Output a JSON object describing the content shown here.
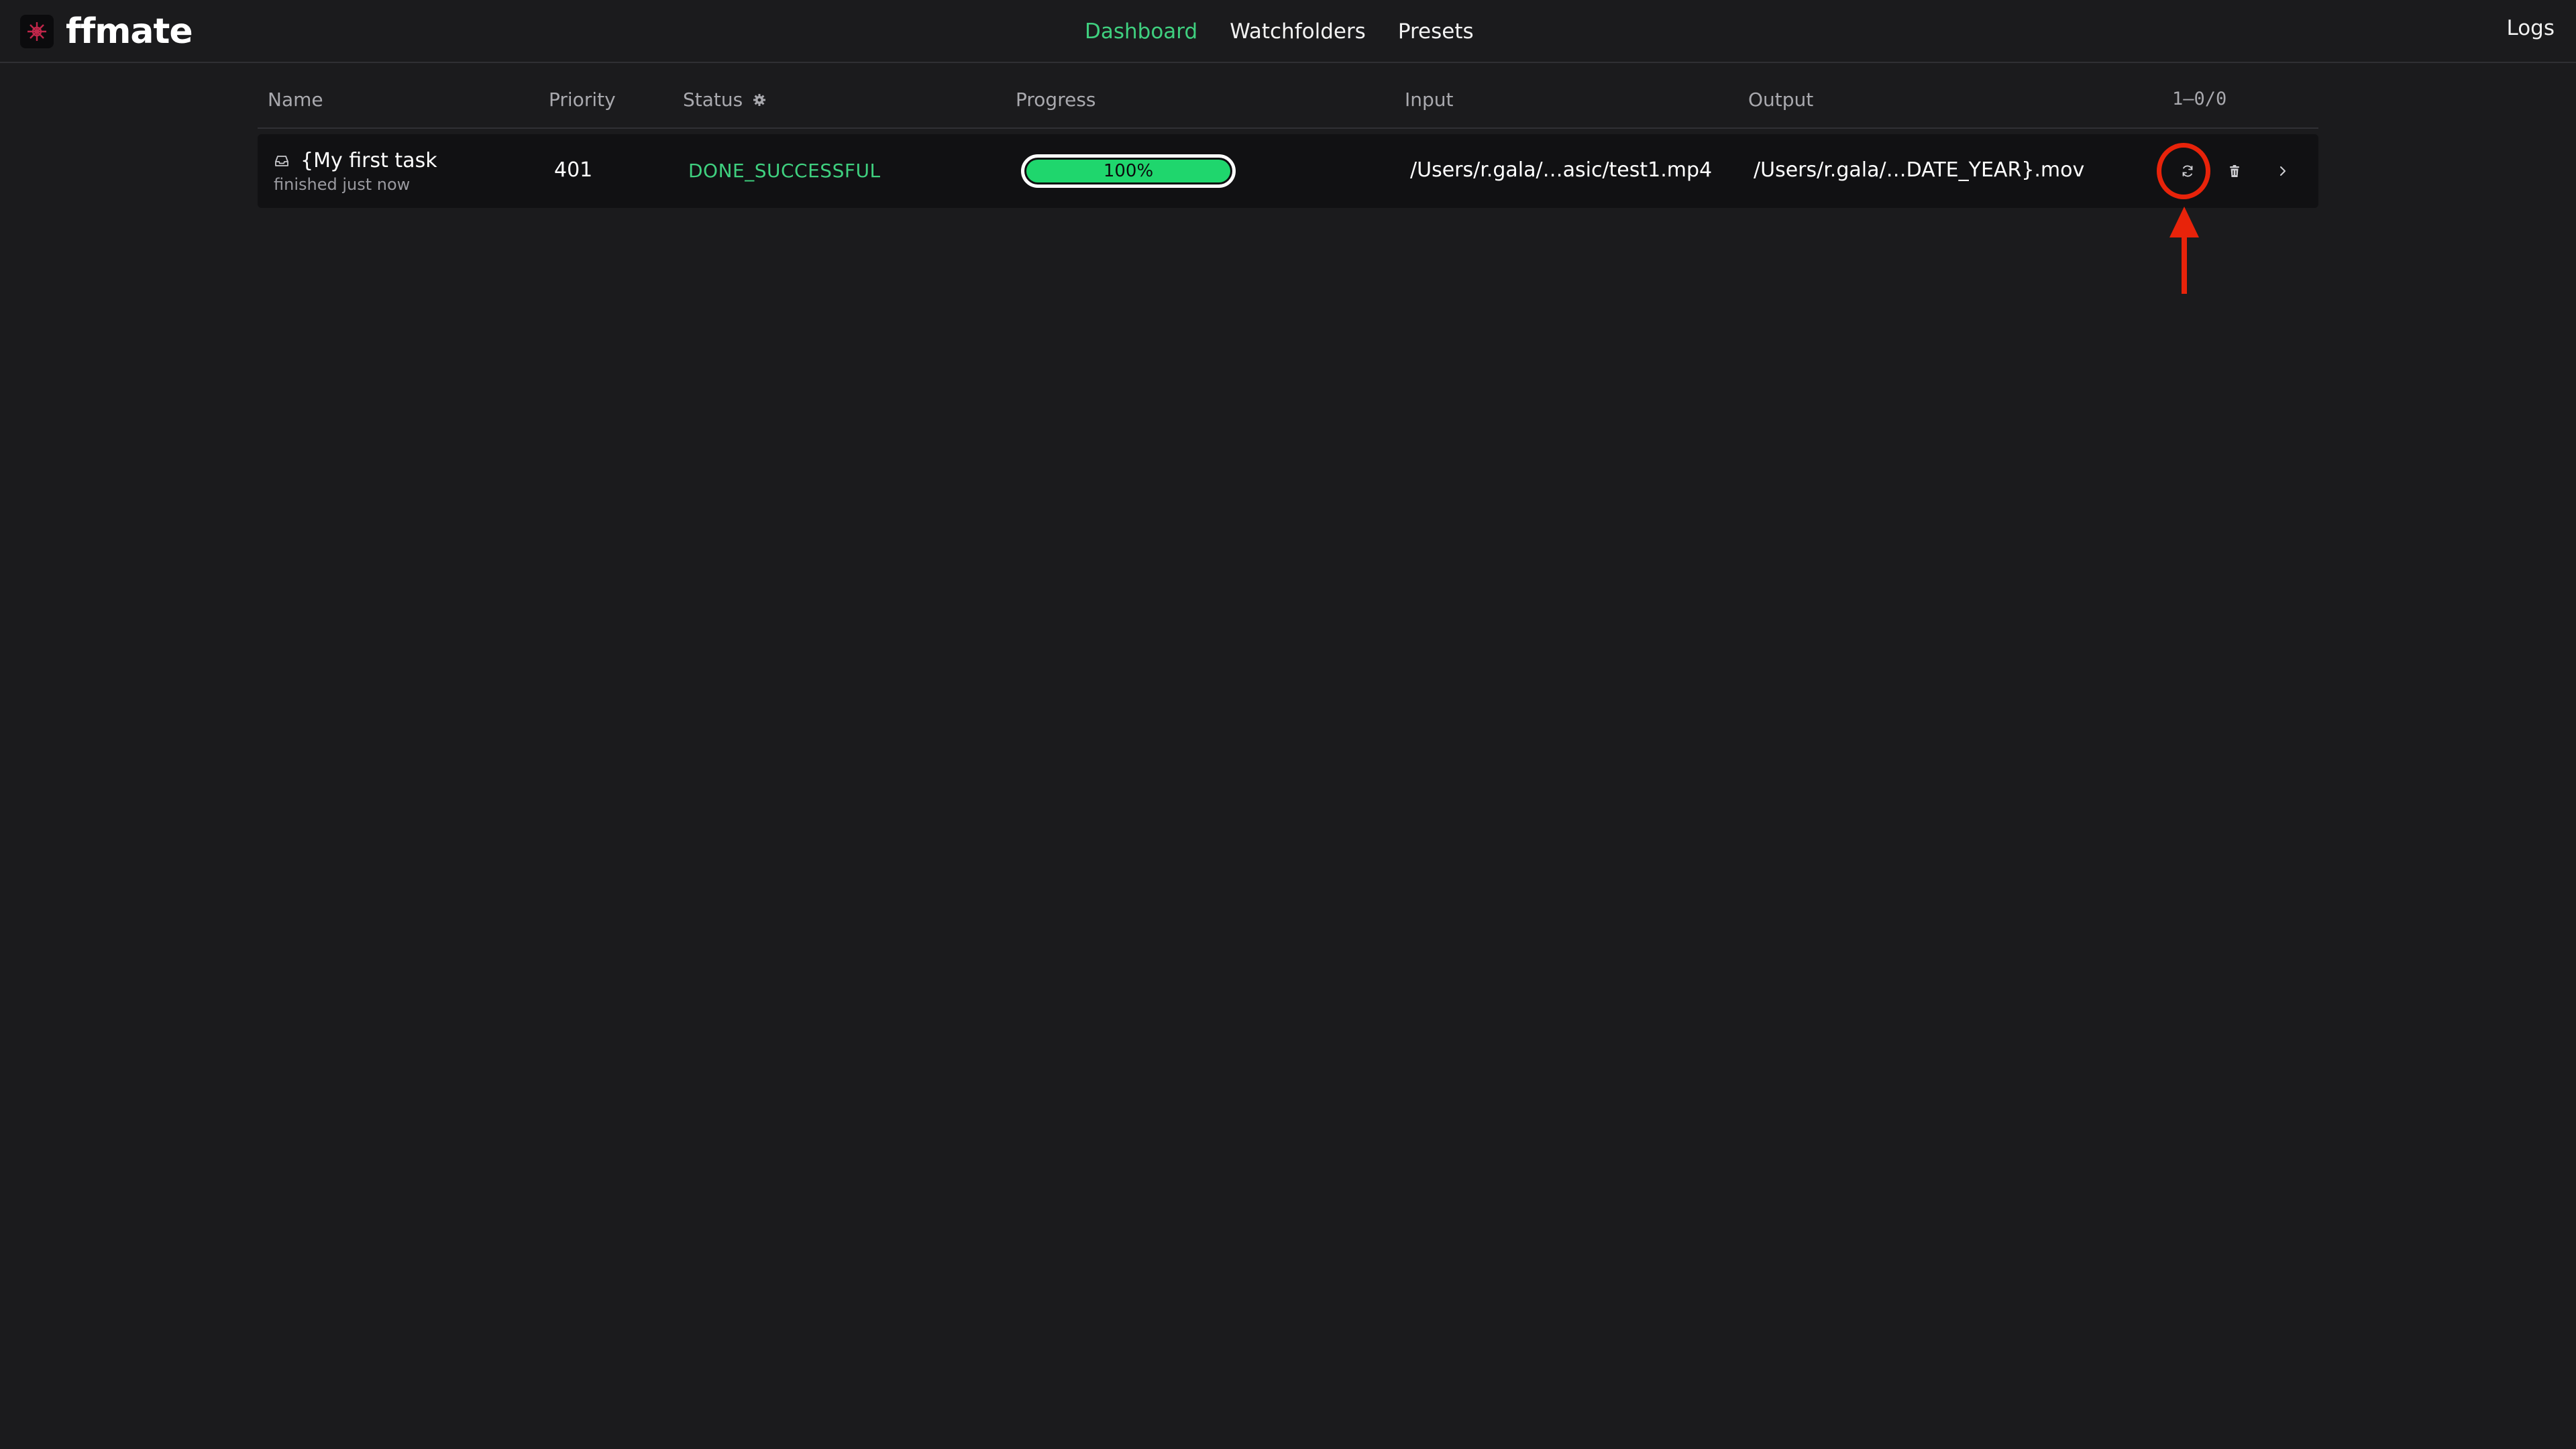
{
  "app": {
    "name": "ffmate"
  },
  "nav": {
    "items": [
      {
        "label": "Dashboard",
        "active": true
      },
      {
        "label": "Watchfolders",
        "active": false
      },
      {
        "label": "Presets",
        "active": false
      }
    ],
    "logs_label": "Logs"
  },
  "table": {
    "columns": {
      "name": "Name",
      "priority": "Priority",
      "status": "Status",
      "progress": "Progress",
      "input": "Input",
      "output": "Output"
    },
    "pagination": "1–0/0",
    "rows": [
      {
        "name": "{My first task",
        "subtitle": "finished just now",
        "priority": "401",
        "status": "DONE_SUCCESSFUL",
        "progress_label": "100%",
        "progress_value": 1.0,
        "input": "/Users/r.gala/…asic/test1.mp4",
        "output": "/Users/r.gala/…DATE_YEAR}.mov"
      }
    ]
  },
  "icons": {
    "logo": "ffmate-logo-icon",
    "status_filter": "gear-icon",
    "task_type": "inbox-icon",
    "restart": "refresh-icon",
    "delete": "trash-icon",
    "open": "chevron-right-icon"
  },
  "colors": {
    "background": "#1b1b1d",
    "accent_green": "#3fd07f",
    "progress_fill": "#1fd66d",
    "annotation_red": "#e8230a",
    "logo_red": "#c0264a"
  }
}
